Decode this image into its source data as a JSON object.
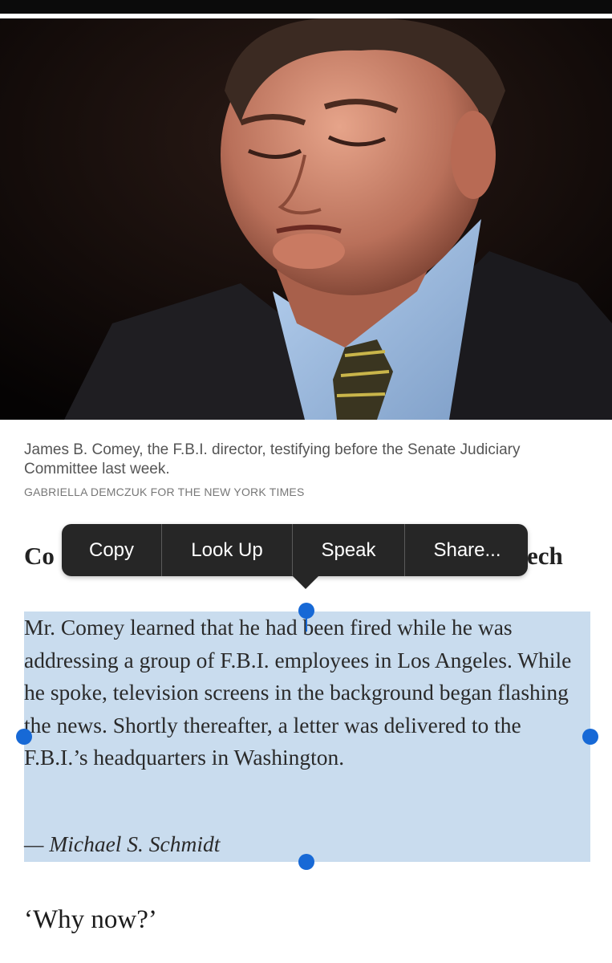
{
  "photo": {
    "description_icon": "portrait-photo-icon"
  },
  "caption": {
    "text": "James B. Comey, the F.B.I. director, testifying before the Senate Judiciary Committee last week.",
    "credit": "GABRIELLA DEMCZUK FOR THE NEW YORK TIMES"
  },
  "heading": {
    "visible_left": "Co",
    "visible_right": "ech"
  },
  "context_menu": {
    "copy": "Copy",
    "look_up": "Look Up",
    "speak": "Speak",
    "share": "Share..."
  },
  "article": {
    "paragraph": "Mr. Comey learned that he had been fired while he was addressing a group of F.B.I. employees in Los Angeles. While he spoke, television screens in the background began flashing the news. Shortly thereafter, a letter was delivered to the F.B.I.’s headquarters in Washington.",
    "byline": "— Michael S. Schmidt",
    "next_heading": "‘Why now?’"
  },
  "colors": {
    "selection": "#c9dcee",
    "handle": "#1769d6",
    "menu_bg": "#262626"
  }
}
